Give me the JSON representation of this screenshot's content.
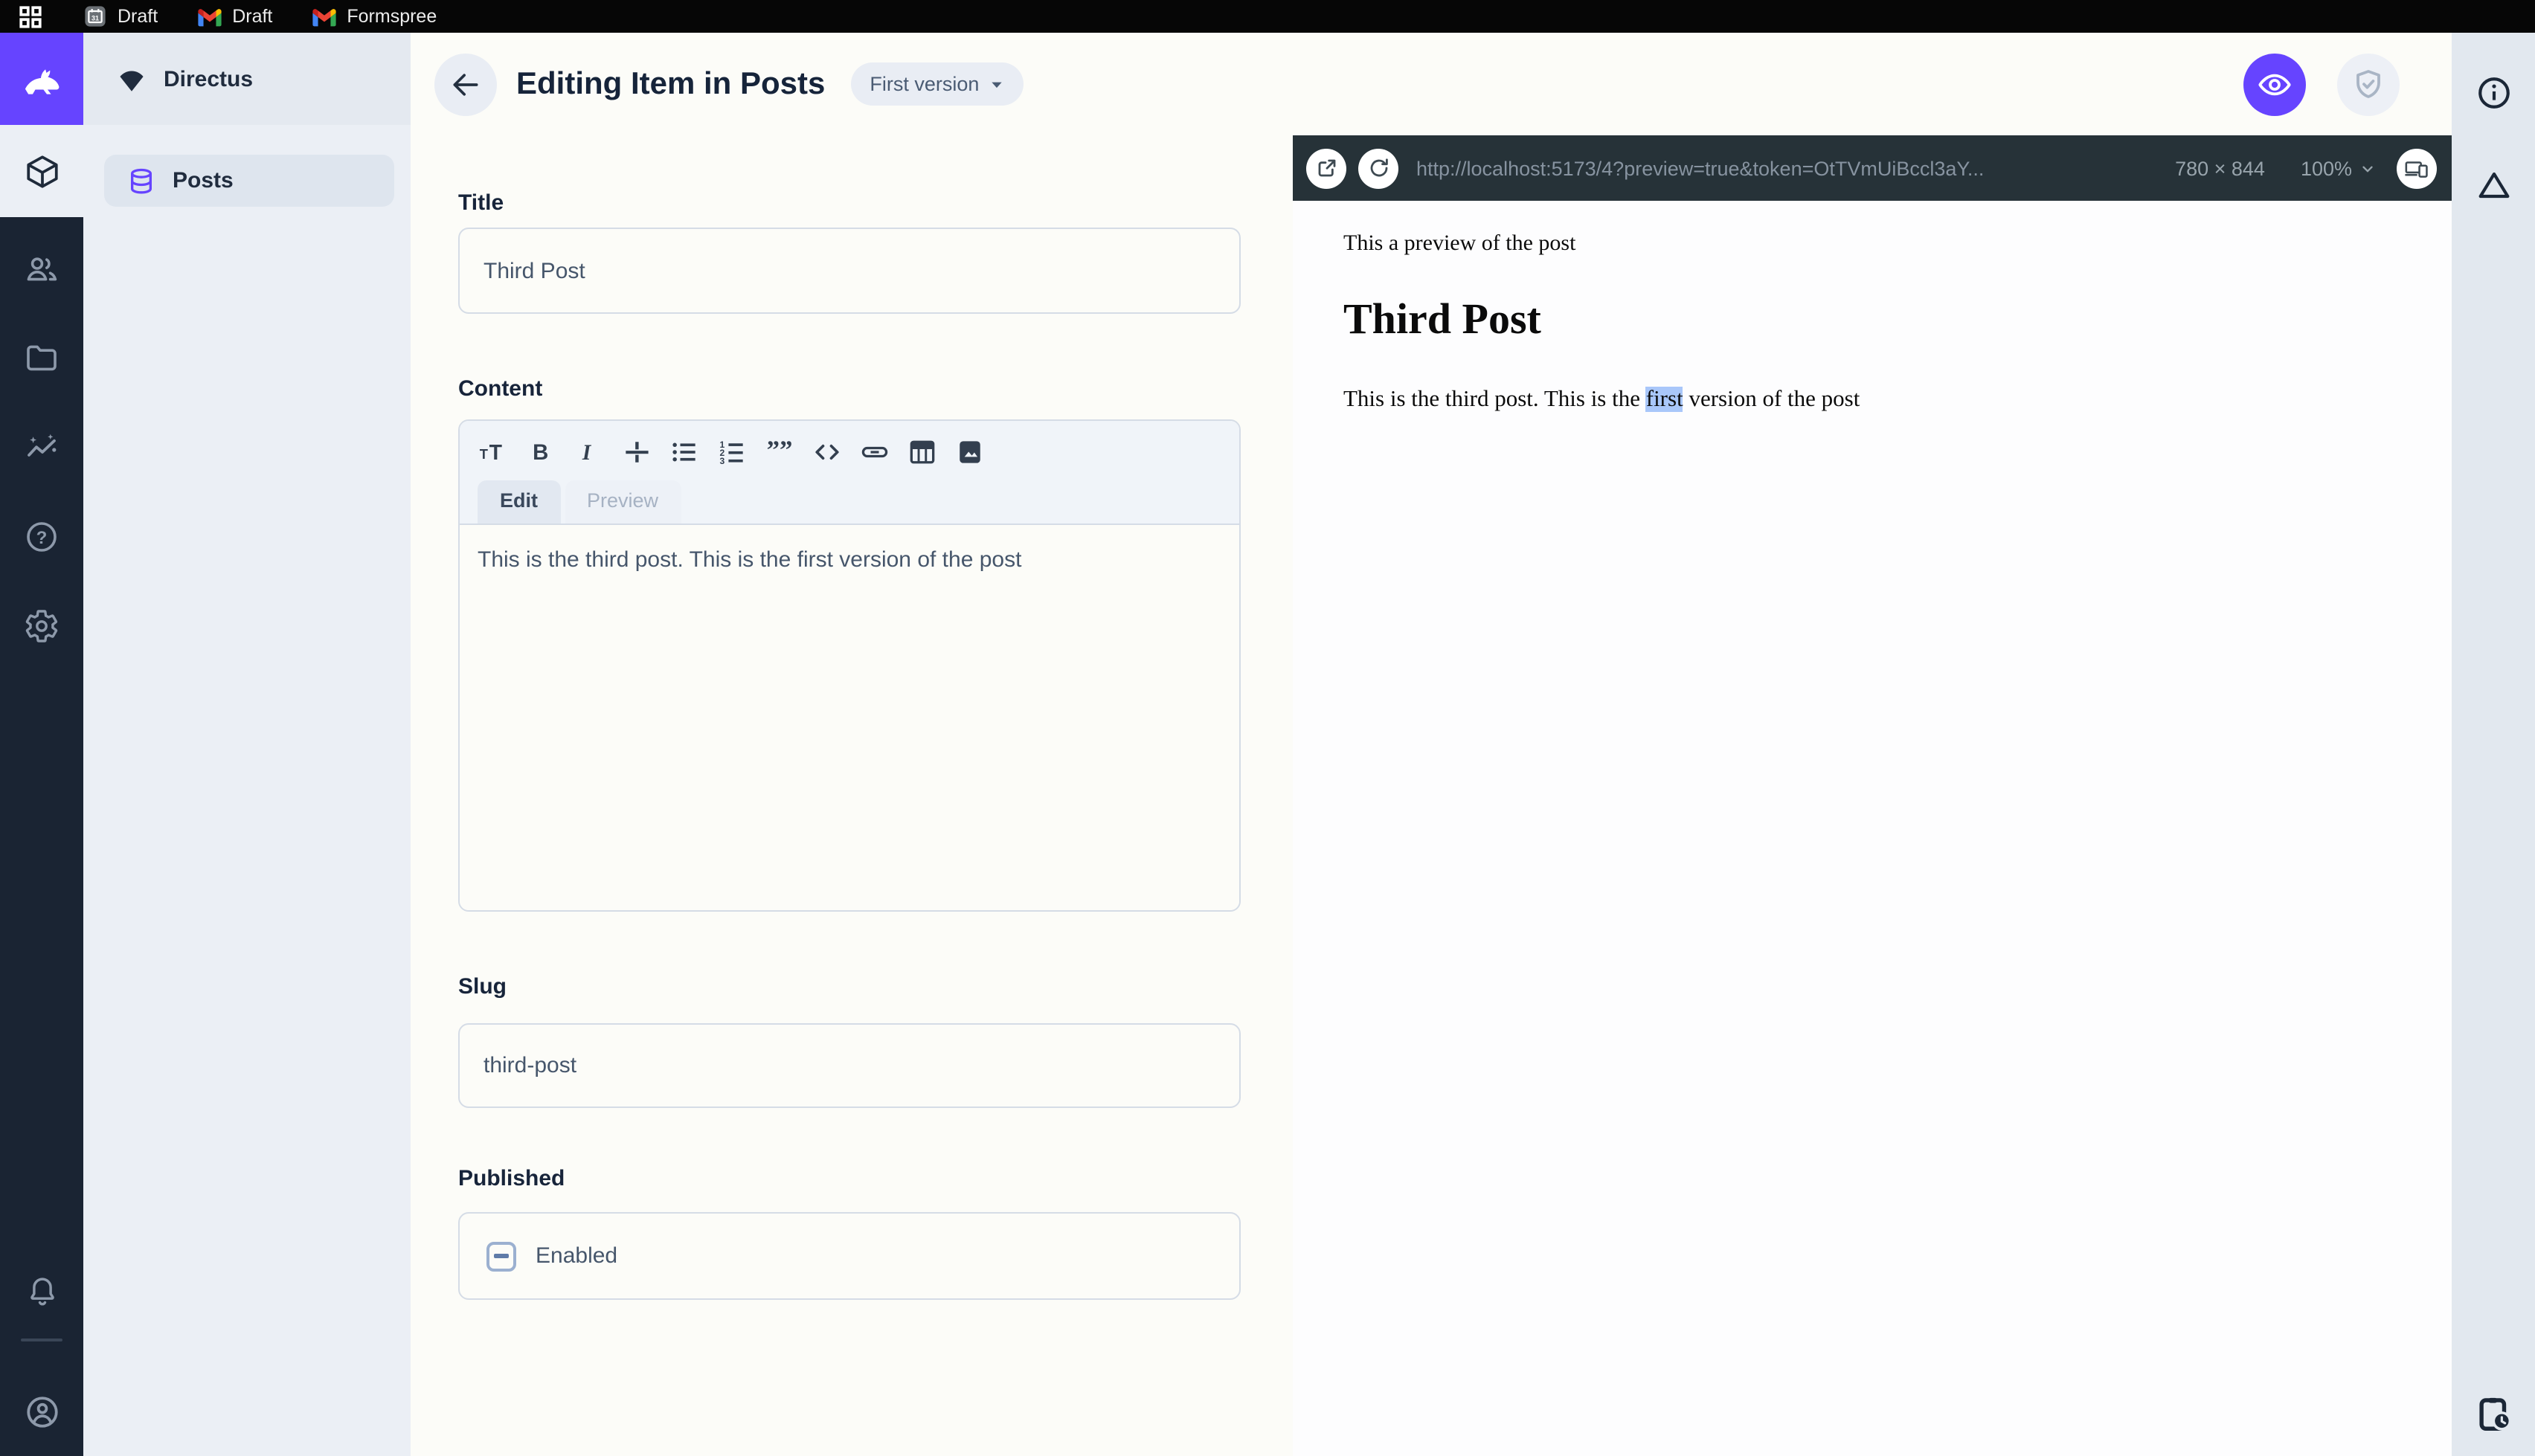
{
  "topbar": {
    "tabs": [
      {
        "icon": "calendar-icon",
        "label": "Draft"
      },
      {
        "icon": "gmail-icon",
        "label": "Draft"
      },
      {
        "icon": "gmail-icon",
        "label": "Formspree"
      }
    ]
  },
  "module_bar": {
    "items": [
      "directus-logo",
      "collections-module",
      "users-module",
      "files-module",
      "insights-module",
      "help-module",
      "settings-module"
    ],
    "bottom": [
      "notifications",
      "user-avatar"
    ]
  },
  "sidebar": {
    "project_name": "Directus",
    "items": [
      {
        "icon": "database-icon",
        "label": "Posts"
      }
    ]
  },
  "header": {
    "title": "Editing Item in Posts",
    "version_label": "First version"
  },
  "form": {
    "title": {
      "label": "Title",
      "value": "Third Post"
    },
    "content": {
      "label": "Content",
      "toolbar_icons": [
        "text-size",
        "bold",
        "italic",
        "strikethrough",
        "bullet-list",
        "ordered-list",
        "blockquote",
        "code",
        "link",
        "table",
        "image"
      ],
      "tabs": [
        {
          "label": "Edit"
        },
        {
          "label": "Preview"
        }
      ],
      "value": "This is the third post. This is the first version of the post"
    },
    "slug": {
      "label": "Slug",
      "value": "third-post"
    },
    "published": {
      "label": "Published",
      "checkbox_label": "Enabled",
      "checkbox_state": "indeterminate"
    }
  },
  "preview": {
    "url": "http://localhost:5173/4?preview=true&token=OtTVmUiBccl3aY...",
    "dimensions": "780 × 844",
    "zoom": "100%",
    "content": {
      "intro": "This a preview of the post",
      "heading": "Third Post",
      "body_before": "This is the third post. This is the ",
      "body_highlight": "first",
      "body_after": " version of the post"
    }
  },
  "colors": {
    "accent": "#6644FF",
    "module_bar_bg": "#1A2433",
    "sidebar_bg": "#EBEFF5",
    "preview_toolbar_bg": "#263238",
    "selection_highlight": "#A9C7FA",
    "text_dark": "#16243A"
  }
}
